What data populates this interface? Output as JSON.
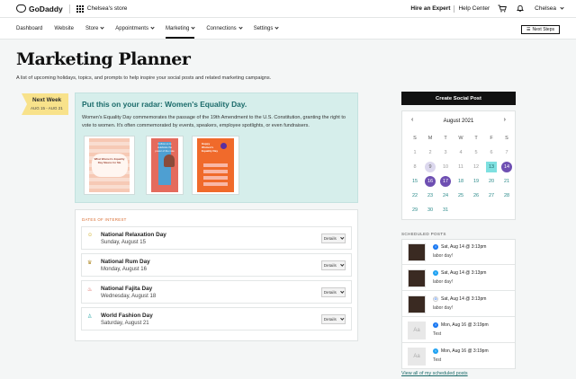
{
  "topbar": {
    "brand": "GoDaddy",
    "store": "Chelsea's store",
    "hire_expert": "Hire an Expert",
    "help_center": "Help Center",
    "user": "Chelsea"
  },
  "nav": {
    "items": [
      {
        "label": "Dashboard",
        "dropdown": false
      },
      {
        "label": "Website",
        "dropdown": false
      },
      {
        "label": "Store",
        "dropdown": true
      },
      {
        "label": "Appointments",
        "dropdown": true
      },
      {
        "label": "Marketing",
        "dropdown": true,
        "active": true
      },
      {
        "label": "Connections",
        "dropdown": true
      },
      {
        "label": "Settings",
        "dropdown": true
      }
    ],
    "next_steps": "Next Steps"
  },
  "page": {
    "title": "Marketing Planner",
    "subtitle": "A list of upcoming holidays, topics, and prompts to help inspire your social posts and related marketing campaigns."
  },
  "week": {
    "label": "Next Week",
    "range": "AUG 15 - AUG 21"
  },
  "radar": {
    "title": "Put this on your radar: Women's Equality Day.",
    "description": "Women's Equality Day commemorates the passage of the 19th Amendment to the U.S. Constitution, granting the right to vote to women. It's often commemorated by events, speakers, employee spotlights, or even fundraisers.",
    "thumbs": [
      "What Women's Equality Day Means for Me",
      "Follow us to celebrate the power of the vote",
      "Happy Women's Equality Day"
    ]
  },
  "dates_of_interest": {
    "heading": "DATES OF INTEREST",
    "details_label": "Details",
    "events": [
      {
        "name": "National Relaxation Day",
        "date": "Sunday, August 15",
        "icon": "relaxation-icon",
        "glyph": "☺"
      },
      {
        "name": "National Rum Day",
        "date": "Monday, August 16",
        "icon": "rum-icon",
        "glyph": "♛"
      },
      {
        "name": "National Fajita Day",
        "date": "Wednesday, August 18",
        "icon": "pepper-icon",
        "glyph": "♨"
      },
      {
        "name": "World Fashion Day",
        "date": "Saturday, August 21",
        "icon": "dress-icon",
        "glyph": "♙"
      }
    ]
  },
  "create_button": "Create Social Post",
  "calendar": {
    "month": "August 2021",
    "dow": [
      "S",
      "M",
      "T",
      "W",
      "T",
      "F",
      "S"
    ],
    "weeks": [
      [
        {
          "d": "1",
          "s": "past"
        },
        {
          "d": "2",
          "s": "past"
        },
        {
          "d": "3",
          "s": "past"
        },
        {
          "d": "4",
          "s": "past"
        },
        {
          "d": "5",
          "s": "past"
        },
        {
          "d": "6",
          "s": "past"
        },
        {
          "d": "7",
          "s": "past"
        }
      ],
      [
        {
          "d": "8",
          "s": "past"
        },
        {
          "d": "9",
          "s": "grey"
        },
        {
          "d": "10",
          "s": "past"
        },
        {
          "d": "11",
          "s": "past"
        },
        {
          "d": "12",
          "s": "past"
        },
        {
          "d": "13",
          "s": "cyan"
        },
        {
          "d": "14",
          "s": "purple"
        }
      ],
      [
        {
          "d": "15",
          "s": "normal"
        },
        {
          "d": "16",
          "s": "purple"
        },
        {
          "d": "17",
          "s": "purple"
        },
        {
          "d": "18",
          "s": "normal"
        },
        {
          "d": "19",
          "s": "normal"
        },
        {
          "d": "20",
          "s": "normal"
        },
        {
          "d": "21",
          "s": "normal"
        }
      ],
      [
        {
          "d": "22",
          "s": "normal"
        },
        {
          "d": "23",
          "s": "normal"
        },
        {
          "d": "24",
          "s": "normal"
        },
        {
          "d": "25",
          "s": "normal"
        },
        {
          "d": "26",
          "s": "normal"
        },
        {
          "d": "27",
          "s": "normal"
        },
        {
          "d": "28",
          "s": "normal"
        }
      ],
      [
        {
          "d": "29",
          "s": "normal"
        },
        {
          "d": "30",
          "s": "normal"
        },
        {
          "d": "31",
          "s": "normal"
        }
      ]
    ]
  },
  "scheduled": {
    "heading": "SCHEDULED POSTS",
    "posts": [
      {
        "when": "Sat, Aug 14 @ 3:13pm",
        "text": "labor day!",
        "network": "fb",
        "img": "photo"
      },
      {
        "when": "Sat, Aug 14 @ 3:13pm",
        "text": "labor day!",
        "network": "tw",
        "img": "photo"
      },
      {
        "when": "Sat, Aug 14 @ 3:13pm",
        "text": "labor day!",
        "network": "gg",
        "img": "photo"
      },
      {
        "when": "Mon, Aug 16 @ 3:19pm",
        "text": "Test",
        "network": "fb",
        "img": "placeholder"
      },
      {
        "when": "Mon, Aug 16 @ 3:19pm",
        "text": "Test",
        "network": "tw",
        "img": "placeholder"
      }
    ],
    "view_all": "View all of my scheduled posts"
  },
  "colors": {
    "accent_teal": "#1b6b6a",
    "radar_bg": "#d6eeeb",
    "ribbon": "#f8e28b",
    "purple": "#6e4fb2",
    "cyan": "#7ee0e0"
  }
}
